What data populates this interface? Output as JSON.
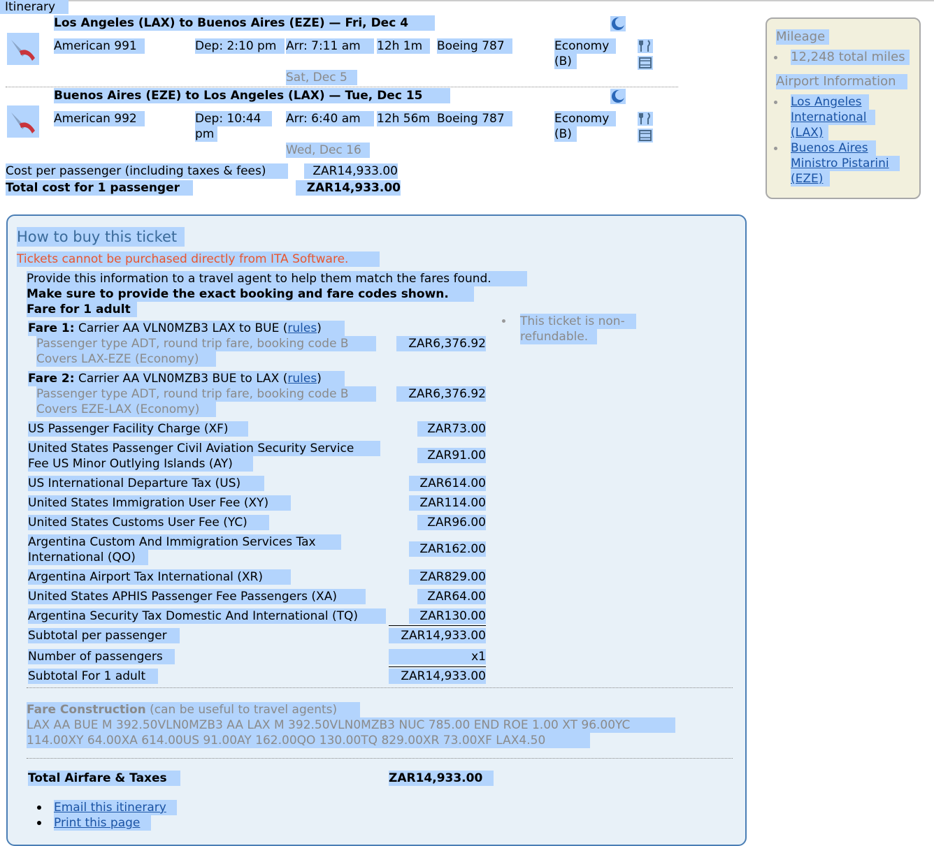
{
  "itinerary": {
    "heading": "Itinerary",
    "legs": [
      {
        "title": "Los Angeles (LAX) to Buenos Aires (EZE) — Fri, Dec 4",
        "flight": "American 991",
        "dep": "Dep: 2:10 pm",
        "arr": "Arr: 7:11 am",
        "duration": "12h 1m",
        "aircraft": "Boeing 787",
        "cabin_1": "Economy",
        "cabin_2": "(B)",
        "arrival_date": "Sat, Dec 5"
      },
      {
        "title": "Buenos Aires (EZE) to Los Angeles (LAX) — Tue, Dec 15",
        "flight": "American 992",
        "dep_1": "Dep: 10:44",
        "dep_2": "pm",
        "arr": "Arr: 6:40 am",
        "duration": "12h 56m",
        "aircraft": "Boeing 787",
        "cabin_1": "Economy",
        "cabin_2": "(B)",
        "arrival_date": "Wed, Dec 16"
      }
    ],
    "cost_per_passenger_label": "Cost per passenger (including taxes & fees)",
    "cost_per_passenger": "ZAR14,933.00",
    "total_label": "Total cost for 1 passenger",
    "total": "ZAR14,933.00"
  },
  "sidebar": {
    "mileage_heading": "Mileage",
    "total_miles": "12,248 total miles",
    "airport_heading": "Airport Information",
    "airport_1": [
      "Los Angeles",
      "International",
      "(LAX)"
    ],
    "airport_2": [
      "Buenos Aires",
      "Ministro Pistarini",
      "(EZE)"
    ]
  },
  "buy": {
    "heading": "How to buy this ticket",
    "warning": "Tickets cannot be purchased directly from ITA Software.",
    "intro": "Provide this information to a travel agent to help them match the fares found.",
    "make_sure": "Make sure to provide the exact booking and fare codes shown.",
    "fare_for": "Fare for 1 adult",
    "non_refundable_1": "This ticket is non-",
    "non_refundable_2": "refundable.",
    "fare1": {
      "label": "Fare 1:",
      "desc": " Carrier AA VLN0MZB3 LAX to BUE (",
      "rules": "rules",
      "close": ")",
      "sub1": "Passenger type ADT, round trip fare, booking code B",
      "sub2": "Covers LAX-EZE (Economy)",
      "amount": "ZAR6,376.92"
    },
    "fare2": {
      "label": "Fare 2:",
      "desc": " Carrier AA VLN0MZB3 BUE to LAX (",
      "rules": "rules",
      "close": ")",
      "sub1": "Passenger type ADT, round trip fare, booking code B",
      "sub2": "Covers EZE-LAX (Economy)",
      "amount": "ZAR6,376.92"
    },
    "taxes": [
      {
        "l1": "US Passenger Facility Charge (XF)",
        "amount": "ZAR73.00"
      },
      {
        "l1": "United States Passenger Civil Aviation Security Service",
        "l2": "Fee US Minor Outlying Islands (AY)",
        "amount": "ZAR91.00"
      },
      {
        "l1": "US International Departure Tax (US)",
        "amount": "ZAR614.00"
      },
      {
        "l1": "United States Immigration User Fee (XY)",
        "amount": "ZAR114.00"
      },
      {
        "l1": "United States Customs User Fee (YC)",
        "amount": "ZAR96.00"
      },
      {
        "l1": "Argentina Custom And Immigration Services Tax",
        "l2": "International (QO)",
        "amount": "ZAR162.00"
      },
      {
        "l1": "Argentina Airport Tax International (XR)",
        "amount": "ZAR829.00"
      },
      {
        "l1": "United States APHIS Passenger Fee Passengers (XA)",
        "amount": "ZAR64.00"
      },
      {
        "l1": "Argentina Security Tax Domestic And International (TQ)",
        "amount": "ZAR130.00"
      }
    ],
    "subtotal_label": "Subtotal per passenger",
    "subtotal": "ZAR14,933.00",
    "num_pass_label": "Number of passengers",
    "num_pass": "x1",
    "subtotal_adult_label": "Subtotal For 1 adult",
    "subtotal_adult": "ZAR14,933.00",
    "fc_label": "Fare Construction",
    "fc_note": " (can be useful to travel agents)",
    "fc_line1": "LAX AA BUE M 392.50VLN0MZB3 AA LAX M 392.50VLN0MZB3 NUC 785.00 END ROE 1.00 XT 96.00YC",
    "fc_line2": "114.00XY 64.00XA 614.00US 91.00AY 162.00QO 130.00TQ 829.00XR 73.00XF LAX4.50",
    "total_label": "Total Airfare & Taxes",
    "total": "ZAR14,933.00",
    "email": "Email this itinerary",
    "print": "Print this page"
  },
  "colors": {
    "selection": "#b3d4fd",
    "warning": "#e8562e",
    "link": "#1a53a4",
    "box_border": "#4a7eb5"
  }
}
